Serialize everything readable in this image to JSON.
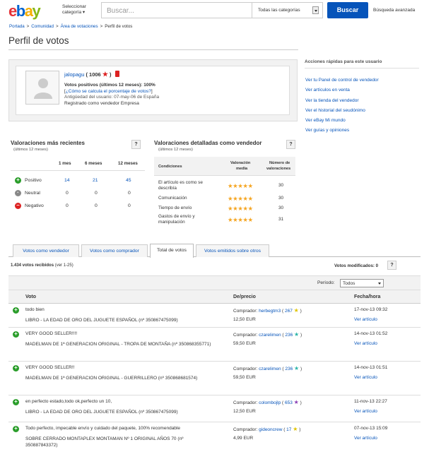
{
  "header": {
    "logo": [
      "e",
      "b",
      "a",
      "y"
    ],
    "select_category": [
      "Seleccionar",
      "categoría"
    ],
    "search_placeholder": "Buscar...",
    "category_value": "Todas las categorías",
    "search_button": "Buscar",
    "advanced_search": "Búsqueda avanzada"
  },
  "breadcrumb": [
    "Portada",
    "Comunidad",
    "Área de votaciones",
    "Perfil de votos"
  ],
  "page_title": "Perfil de votos",
  "profile": {
    "username": "jalopagu",
    "score": "1006",
    "positive": "Votos positivos (últimos 12 meses): 100%",
    "how_calculated": "¿Cómo se calcula el porcentaje de votos?",
    "seniority": "Antigüedad del usuario: 07-may-06 de España",
    "registered": "Registrado como vendedor Empresa"
  },
  "quick_actions": {
    "title": "Acciones rápidas para este usuario",
    "items": [
      "Ver tu Panel de control de vendedor",
      "Ver artículos en venta",
      "Ver la tienda del vendedor",
      "Ver el historial del seudónimo",
      "Ver eBay Mi mundo",
      "Ver guías y opiniones"
    ]
  },
  "recent": {
    "title": "Valoraciones más recientes",
    "subtitle": "(últimos 12 meses)",
    "help": "?",
    "columns": [
      "1 mes",
      "6 meses",
      "12 meses"
    ],
    "rows": [
      {
        "label": "Positivo",
        "values": [
          "14",
          "21",
          "45"
        ],
        "type": "pos"
      },
      {
        "label": "Neutral",
        "values": [
          "0",
          "0",
          "0"
        ],
        "type": "neu"
      },
      {
        "label": "Negativo",
        "values": [
          "0",
          "0",
          "0"
        ],
        "type": "neg"
      }
    ]
  },
  "detailed": {
    "title": "Valoraciones detalladas como vendedor",
    "subtitle": "(últimos 12 meses)",
    "help": "?",
    "columns": [
      "Condiciones",
      "Valoración",
      "media",
      "Número de",
      "valoraciones"
    ],
    "rows": [
      {
        "label": [
          "El artículo es como se",
          "describía"
        ],
        "stars": "★★★★★",
        "count": "30"
      },
      {
        "label": [
          "Comunicación"
        ],
        "stars": "★★★★★",
        "count": "30"
      },
      {
        "label": [
          "Tiempo de envío"
        ],
        "stars": "★★★★★",
        "count": "30"
      },
      {
        "label": [
          "Gastos de envío y",
          "manipulación"
        ],
        "stars": "★★★★★",
        "count": "31"
      }
    ]
  },
  "tabs": [
    "Votos como vendedor",
    "Votos como comprador",
    "Total de votos",
    "Votos emitidos sobre otros"
  ],
  "count": {
    "bold": "1.434 votos recibidos",
    "range": "(ver 1-25)"
  },
  "modified": "Votos modificados: 0",
  "filter": {
    "label": "Período:",
    "value": "Todos"
  },
  "table_head": [
    "Voto",
    "De/precio",
    "Fecha/hora"
  ],
  "feedback": [
    {
      "comment": "todo bien",
      "item": "LIBRO - LA EDAD DE ORO DEL JUGUETE ESPAÑOL (nº 350867475099)",
      "role": "Comprador:",
      "buyer": "herbegtm3",
      "bscore": "267",
      "price": "12,50 EUR",
      "date": "17-nov-13 09:32",
      "view": "Ver artículo"
    },
    {
      "comment": "VERY GOOD SELLER!!!!",
      "item": "MADELMAN DE 1ª GENERACION ORIGINAL - TROPA DE MONTAÑA (nº 350868355771)",
      "role": "Comprador:",
      "buyer": "czarelimen",
      "bscore": "236",
      "price": "59,50 EUR",
      "date": "14-nov-13 01:52",
      "view": "Ver artículo"
    },
    {
      "comment": "VERY GOOD SELLER!!",
      "item": "MADELMAN DE 1ª GENERACION ORIGINAL - GUERRILLERO (nº 350868681574)",
      "role": "Comprador:",
      "buyer": "czarelimen",
      "bscore": "236",
      "price": "59,50 EUR",
      "date": "14-nov-13 01:51",
      "view": "Ver artículo"
    },
    {
      "comment": "en perfecto estado,todo ok,perfecto un 10,",
      "item": "LIBRO - LA EDAD DE ORO DEL JUGUETE ESPAÑOL (nº 350867475099)",
      "role": "Comprador:",
      "buyer": "colombojlp",
      "bscore": "653",
      "price": "12,50 EUR",
      "date": "11-nov-13 22:27",
      "view": "Ver artículo"
    },
    {
      "comment": "Todo perfecto, impecable envío y cuidado del paquete, 100% recomendable",
      "item": "SOBRE CERRADO MONTAPLEX MONTAMAN Nº 1 ORIGINAL AÑOS 70 (nº 350887843372)",
      "role": "Comprador:",
      "buyer": "gideoncrew",
      "bscore": "17",
      "price": "4,99 EUR",
      "date": "07-nov-13 15:09",
      "view": "Ver artículo"
    }
  ]
}
